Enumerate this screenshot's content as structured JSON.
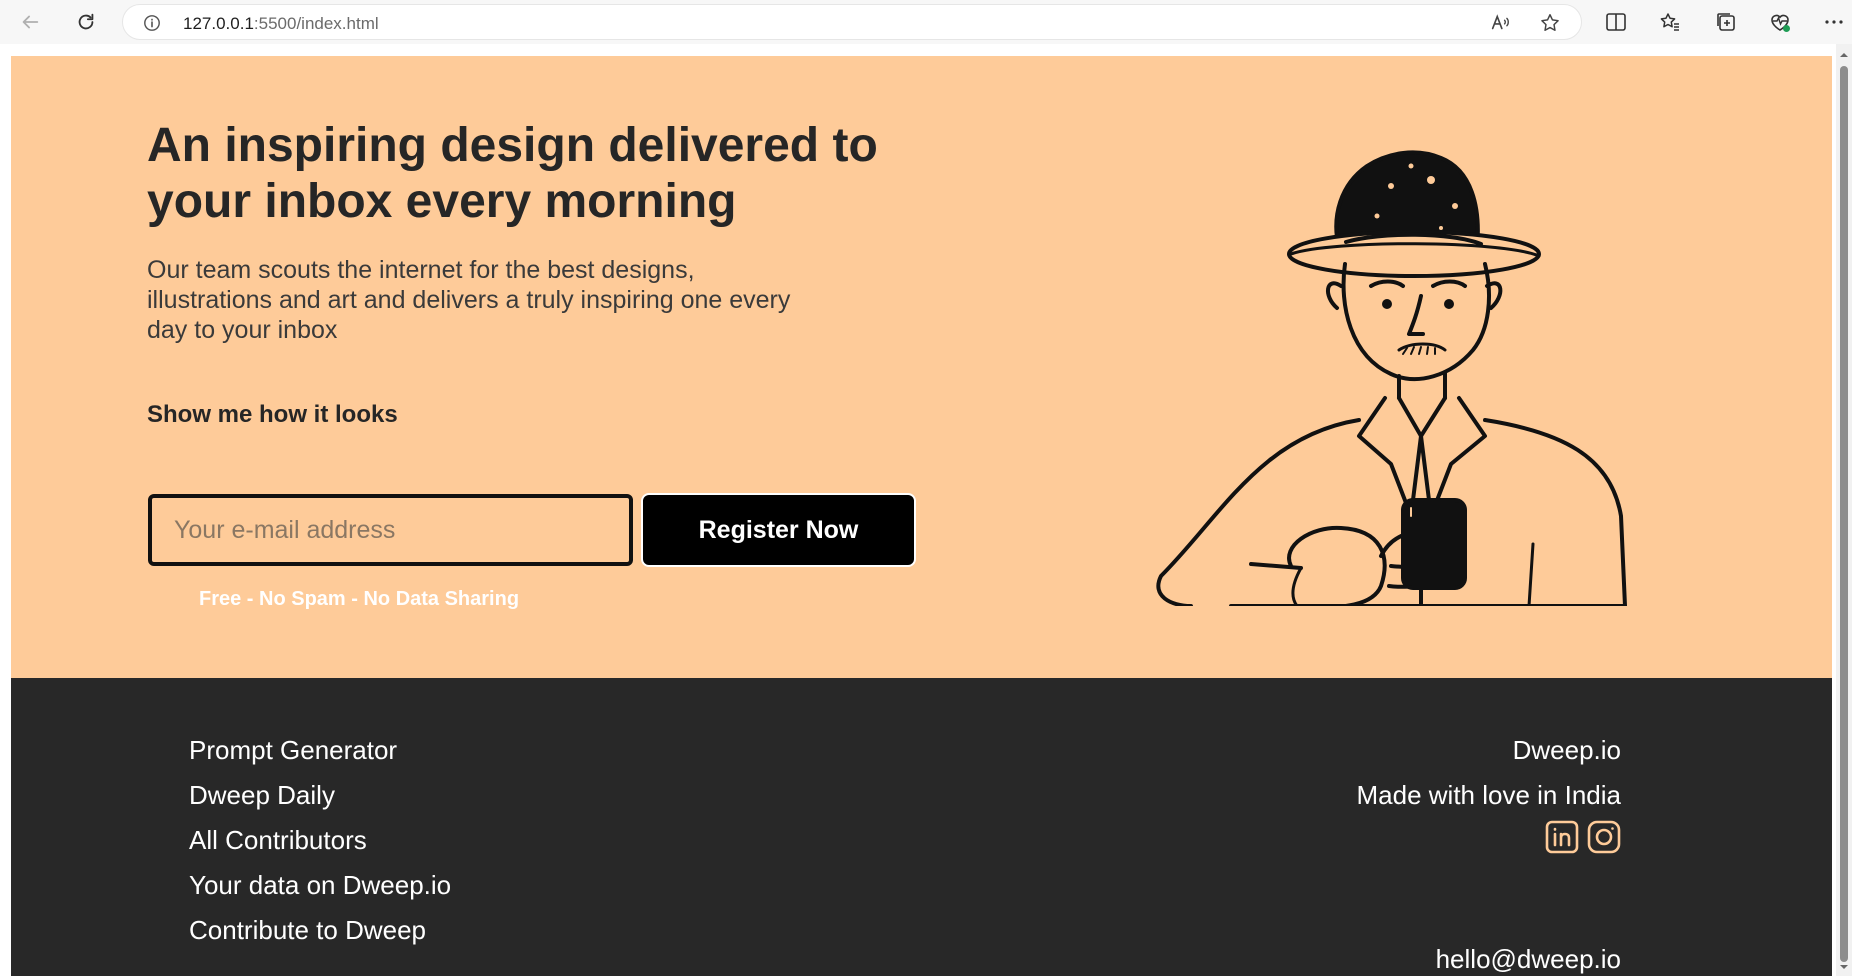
{
  "browser": {
    "url_host": "127.0.0.1",
    "url_rest": ":5500/index.html"
  },
  "hero": {
    "title": "An inspiring design delivered to your inbox every morning",
    "subtitle": "Our team scouts the internet for the best designs, illustrations and art and delivers a truly inspiring one every day to your inbox",
    "show_link": "Show me how it looks",
    "email_placeholder": "Your e-mail address",
    "register_label": "Register Now",
    "note": "Free - No Spam - No Data Sharing",
    "background_color": "#fecb99"
  },
  "footer": {
    "links": [
      "Prompt Generator",
      "Dweep Daily",
      "All Contributors",
      "Your data on Dweep.io",
      "Contribute to Dweep"
    ],
    "brand": "Dweep.io",
    "tagline": "Made with love in India",
    "social_icons": [
      "linkedin-icon",
      "instagram-icon"
    ],
    "email": "hello@dweep.io",
    "background_color": "#282828",
    "icon_color": "#fecb99"
  }
}
